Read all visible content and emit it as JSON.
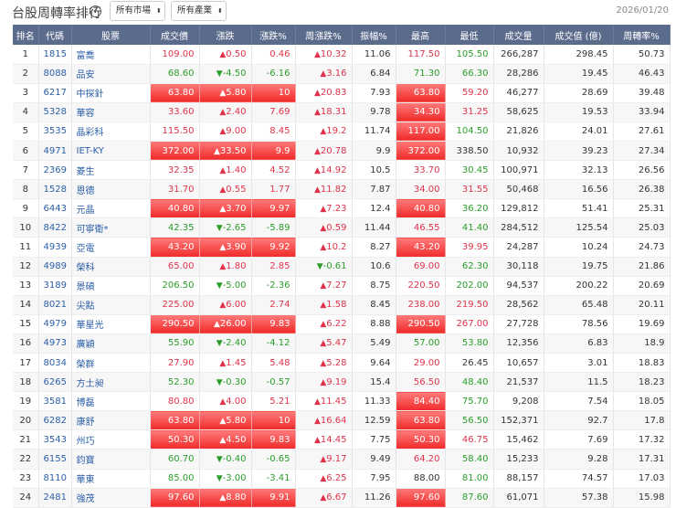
{
  "header": {
    "title": "台股周轉率排行",
    "help_icon": "?",
    "market_select": "所有市場",
    "industry_select": "所有產業",
    "date": "2026/01/20"
  },
  "columns": [
    "排名",
    "代碼",
    "股票",
    "成交價",
    "漲跌",
    "漲跌%",
    "周漲跌%",
    "振幅%",
    "最高",
    "最低",
    "成交量",
    "成交值 (億)",
    "周轉率%"
  ],
  "colors": {
    "up": "#e0334a",
    "down": "#2a9d2a",
    "header": "#5b6b8c",
    "limit": "#f02a2a"
  },
  "rows": [
    {
      "rank": "1",
      "code": "1815",
      "name": "富喬",
      "price": "109.00",
      "change": "0.50",
      "pct": "0.46",
      "week": "10.32",
      "amp": "11.06",
      "high": "117.50",
      "low": "105.50",
      "vol": "266,287",
      "val": "298.45",
      "turn": "50.73",
      "dir": "up",
      "wdir": "up",
      "hdir": "up",
      "ldir": "down",
      "limit": false,
      "hlimit": false
    },
    {
      "rank": "2",
      "code": "8088",
      "name": "品安",
      "price": "68.60",
      "change": "-4.50",
      "pct": "-6.16",
      "week": "3.16",
      "amp": "6.84",
      "high": "71.30",
      "low": "66.30",
      "vol": "28,286",
      "val": "19.45",
      "turn": "46.43",
      "dir": "down",
      "wdir": "up",
      "hdir": "down",
      "ldir": "down",
      "limit": false,
      "hlimit": false
    },
    {
      "rank": "3",
      "code": "6217",
      "name": "中探針",
      "price": "63.80",
      "change": "5.80",
      "pct": "10",
      "week": "20.83",
      "amp": "7.93",
      "high": "63.80",
      "low": "59.20",
      "vol": "46,277",
      "val": "28.69",
      "turn": "39.48",
      "dir": "up",
      "wdir": "up",
      "hdir": "up",
      "ldir": "up",
      "limit": true,
      "hlimit": true
    },
    {
      "rank": "4",
      "code": "5328",
      "name": "華容",
      "price": "33.60",
      "change": "2.40",
      "pct": "7.69",
      "week": "18.31",
      "amp": "9.78",
      "high": "34.30",
      "low": "31.25",
      "vol": "58,625",
      "val": "19.53",
      "turn": "33.94",
      "dir": "up",
      "wdir": "up",
      "hdir": "up",
      "ldir": "up",
      "limit": false,
      "hlimit": true
    },
    {
      "rank": "5",
      "code": "3535",
      "name": "晶彩科",
      "price": "115.50",
      "change": "9.00",
      "pct": "8.45",
      "week": "19.2",
      "amp": "11.74",
      "high": "117.00",
      "low": "104.50",
      "vol": "21,826",
      "val": "24.01",
      "turn": "27.61",
      "dir": "up",
      "wdir": "up",
      "hdir": "up",
      "ldir": "down",
      "limit": false,
      "hlimit": true
    },
    {
      "rank": "6",
      "code": "4971",
      "name": "IET-KY",
      "price": "372.00",
      "change": "33.50",
      "pct": "9.9",
      "week": "20.78",
      "amp": "9.9",
      "high": "372.00",
      "low": "338.50",
      "vol": "10,932",
      "val": "39.23",
      "turn": "27.34",
      "dir": "up",
      "wdir": "up",
      "hdir": "up",
      "ldir": "flat",
      "limit": true,
      "hlimit": true
    },
    {
      "rank": "7",
      "code": "2369",
      "name": "菱生",
      "price": "32.35",
      "change": "1.40",
      "pct": "4.52",
      "week": "14.92",
      "amp": "10.5",
      "high": "33.70",
      "low": "30.45",
      "vol": "100,971",
      "val": "32.13",
      "turn": "26.56",
      "dir": "up",
      "wdir": "up",
      "hdir": "up",
      "ldir": "down",
      "limit": false,
      "hlimit": false
    },
    {
      "rank": "8",
      "code": "1528",
      "name": "恩德",
      "price": "31.70",
      "change": "0.55",
      "pct": "1.77",
      "week": "11.82",
      "amp": "7.87",
      "high": "34.00",
      "low": "31.55",
      "vol": "50,468",
      "val": "16.56",
      "turn": "26.38",
      "dir": "up",
      "wdir": "up",
      "hdir": "up",
      "ldir": "up",
      "limit": false,
      "hlimit": false
    },
    {
      "rank": "9",
      "code": "6443",
      "name": "元晶",
      "price": "40.80",
      "change": "3.70",
      "pct": "9.97",
      "week": "7.23",
      "amp": "12.4",
      "high": "40.80",
      "low": "36.20",
      "vol": "129,812",
      "val": "51.41",
      "turn": "25.31",
      "dir": "up",
      "wdir": "up",
      "hdir": "up",
      "ldir": "down",
      "limit": true,
      "hlimit": true
    },
    {
      "rank": "10",
      "code": "8422",
      "name": "可寧衛*",
      "price": "42.35",
      "change": "-2.65",
      "pct": "-5.89",
      "week": "0.59",
      "amp": "11.44",
      "high": "46.55",
      "low": "41.40",
      "vol": "284,512",
      "val": "125.54",
      "turn": "25.03",
      "dir": "down",
      "wdir": "up",
      "hdir": "up",
      "ldir": "down",
      "limit": false,
      "hlimit": false
    },
    {
      "rank": "11",
      "code": "4939",
      "name": "亞電",
      "price": "43.20",
      "change": "3.90",
      "pct": "9.92",
      "week": "10.2",
      "amp": "8.27",
      "high": "43.20",
      "low": "39.95",
      "vol": "24,287",
      "val": "10.24",
      "turn": "24.73",
      "dir": "up",
      "wdir": "up",
      "hdir": "up",
      "ldir": "up",
      "limit": true,
      "hlimit": true
    },
    {
      "rank": "12",
      "code": "4989",
      "name": "榮科",
      "price": "65.00",
      "change": "1.80",
      "pct": "2.85",
      "week": "-0.61",
      "amp": "10.6",
      "high": "69.00",
      "low": "62.30",
      "vol": "30,118",
      "val": "19.75",
      "turn": "21.86",
      "dir": "up",
      "wdir": "down",
      "hdir": "up",
      "ldir": "down",
      "limit": false,
      "hlimit": false
    },
    {
      "rank": "13",
      "code": "3189",
      "name": "景碩",
      "price": "206.50",
      "change": "-5.00",
      "pct": "-2.36",
      "week": "7.27",
      "amp": "8.75",
      "high": "220.50",
      "low": "202.00",
      "vol": "94,537",
      "val": "200.22",
      "turn": "20.69",
      "dir": "down",
      "wdir": "up",
      "hdir": "up",
      "ldir": "down",
      "limit": false,
      "hlimit": false
    },
    {
      "rank": "14",
      "code": "8021",
      "name": "尖點",
      "price": "225.00",
      "change": "6.00",
      "pct": "2.74",
      "week": "1.58",
      "amp": "8.45",
      "high": "238.00",
      "low": "219.50",
      "vol": "28,562",
      "val": "65.48",
      "turn": "20.11",
      "dir": "up",
      "wdir": "up",
      "hdir": "up",
      "ldir": "up",
      "limit": false,
      "hlimit": false
    },
    {
      "rank": "15",
      "code": "4979",
      "name": "華星光",
      "price": "290.50",
      "change": "26.00",
      "pct": "9.83",
      "week": "6.22",
      "amp": "8.88",
      "high": "290.50",
      "low": "267.00",
      "vol": "27,728",
      "val": "78.56",
      "turn": "19.69",
      "dir": "up",
      "wdir": "up",
      "hdir": "up",
      "ldir": "up",
      "limit": true,
      "hlimit": true
    },
    {
      "rank": "16",
      "code": "4973",
      "name": "廣穎",
      "price": "55.90",
      "change": "-2.40",
      "pct": "-4.12",
      "week": "5.47",
      "amp": "5.49",
      "high": "57.00",
      "low": "53.80",
      "vol": "12,356",
      "val": "6.83",
      "turn": "18.9",
      "dir": "down",
      "wdir": "up",
      "hdir": "down",
      "ldir": "down",
      "limit": false,
      "hlimit": false
    },
    {
      "rank": "17",
      "code": "8034",
      "name": "榮群",
      "price": "27.90",
      "change": "1.45",
      "pct": "5.48",
      "week": "5.28",
      "amp": "9.64",
      "high": "29.00",
      "low": "26.45",
      "vol": "10,657",
      "val": "3.01",
      "turn": "18.83",
      "dir": "up",
      "wdir": "up",
      "hdir": "up",
      "ldir": "flat",
      "limit": false,
      "hlimit": false
    },
    {
      "rank": "18",
      "code": "6265",
      "name": "方土昶",
      "price": "52.30",
      "change": "-0.30",
      "pct": "-0.57",
      "week": "9.19",
      "amp": "15.4",
      "high": "56.50",
      "low": "48.40",
      "vol": "21,537",
      "val": "11.5",
      "turn": "18.23",
      "dir": "down",
      "wdir": "up",
      "hdir": "up",
      "ldir": "down",
      "limit": false,
      "hlimit": false
    },
    {
      "rank": "19",
      "code": "3581",
      "name": "博磊",
      "price": "80.80",
      "change": "4.00",
      "pct": "5.21",
      "week": "11.45",
      "amp": "11.33",
      "high": "84.40",
      "low": "75.70",
      "vol": "9,208",
      "val": "7.54",
      "turn": "18.05",
      "dir": "up",
      "wdir": "up",
      "hdir": "up",
      "ldir": "down",
      "limit": false,
      "hlimit": true
    },
    {
      "rank": "20",
      "code": "6282",
      "name": "康舒",
      "price": "63.80",
      "change": "5.80",
      "pct": "10",
      "week": "16.64",
      "amp": "12.59",
      "high": "63.80",
      "low": "56.50",
      "vol": "152,371",
      "val": "92.7",
      "turn": "17.8",
      "dir": "up",
      "wdir": "up",
      "hdir": "up",
      "ldir": "down",
      "limit": true,
      "hlimit": true
    },
    {
      "rank": "21",
      "code": "3543",
      "name": "州巧",
      "price": "50.30",
      "change": "4.50",
      "pct": "9.83",
      "week": "14.45",
      "amp": "7.75",
      "high": "50.30",
      "low": "46.75",
      "vol": "15,462",
      "val": "7.69",
      "turn": "17.32",
      "dir": "up",
      "wdir": "up",
      "hdir": "up",
      "ldir": "up",
      "limit": true,
      "hlimit": true
    },
    {
      "rank": "22",
      "code": "6155",
      "name": "鈞寶",
      "price": "60.70",
      "change": "-0.40",
      "pct": "-0.65",
      "week": "9.17",
      "amp": "9.49",
      "high": "64.20",
      "low": "58.40",
      "vol": "15,233",
      "val": "9.28",
      "turn": "17.31",
      "dir": "down",
      "wdir": "up",
      "hdir": "up",
      "ldir": "down",
      "limit": false,
      "hlimit": false
    },
    {
      "rank": "23",
      "code": "8110",
      "name": "華東",
      "price": "85.00",
      "change": "-3.00",
      "pct": "-3.41",
      "week": "6.25",
      "amp": "7.95",
      "high": "88.00",
      "low": "81.00",
      "vol": "88,157",
      "val": "74.57",
      "turn": "17.03",
      "dir": "down",
      "wdir": "up",
      "hdir": "flat",
      "ldir": "down",
      "limit": false,
      "hlimit": false
    },
    {
      "rank": "24",
      "code": "2481",
      "name": "強茂",
      "price": "97.60",
      "change": "8.80",
      "pct": "9.91",
      "week": "6.67",
      "amp": "11.26",
      "high": "97.60",
      "low": "87.60",
      "vol": "61,071",
      "val": "57.38",
      "turn": "15.98",
      "dir": "up",
      "wdir": "up",
      "hdir": "up",
      "ldir": "down",
      "limit": true,
      "hlimit": true
    }
  ]
}
